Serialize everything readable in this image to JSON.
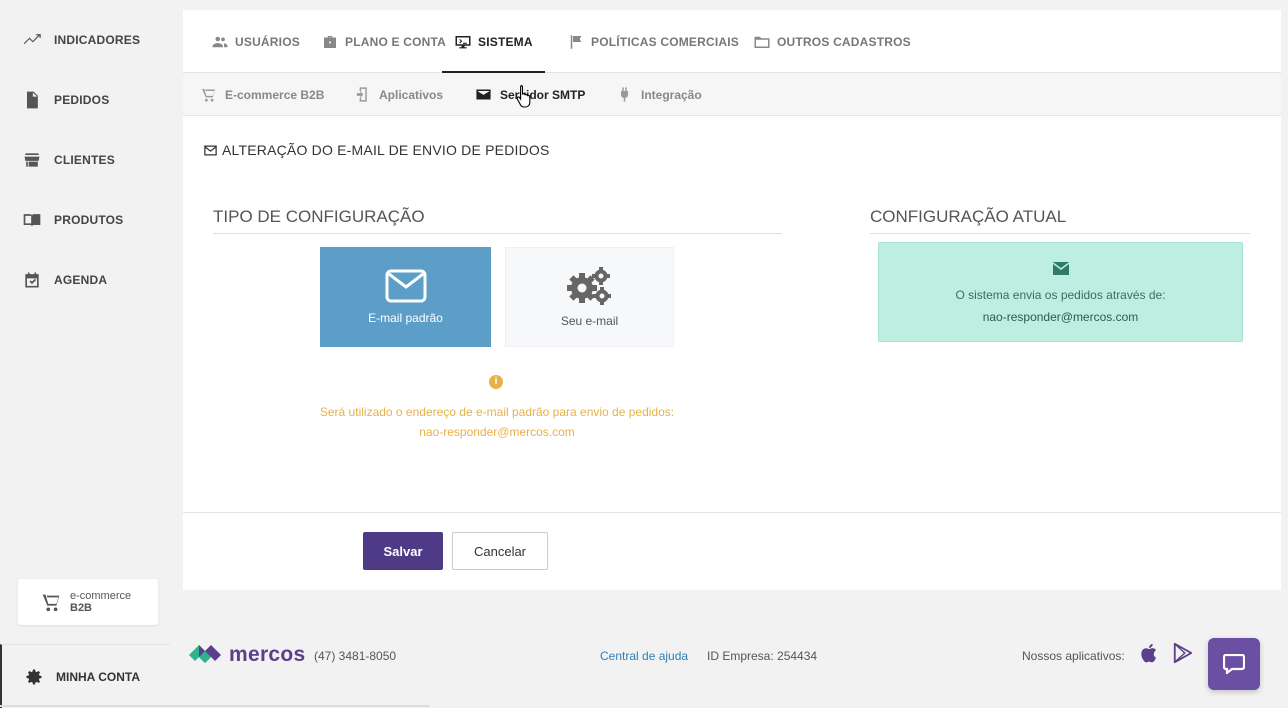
{
  "sidebar": {
    "items": [
      {
        "label": "INDICADORES",
        "icon": "trending-up-icon"
      },
      {
        "label": "PEDIDOS",
        "icon": "document-icon"
      },
      {
        "label": "CLIENTES",
        "icon": "store-icon"
      },
      {
        "label": "PRODUTOS",
        "icon": "book-icon"
      },
      {
        "label": "AGENDA",
        "icon": "calendar-check-icon"
      }
    ],
    "ecommerce": {
      "line1": "e-commerce",
      "line2": "B2B"
    },
    "account": {
      "label": "MINHA CONTA",
      "icon": "gear-icon"
    }
  },
  "tabs": [
    {
      "label": "USUÁRIOS",
      "icon": "users-icon"
    },
    {
      "label": "PLANO E CONTA",
      "icon": "briefcase-icon"
    },
    {
      "label": "SISTEMA",
      "icon": "monitor-icon",
      "active": true
    },
    {
      "label": "POLÍTICAS COMERCIAIS",
      "icon": "flag-icon"
    },
    {
      "label": "OUTROS CADASTROS",
      "icon": "folder-icon"
    }
  ],
  "subtabs": [
    {
      "label": "E-commerce B2B",
      "icon": "cart-icon"
    },
    {
      "label": "Aplicativos",
      "icon": "app-icon"
    },
    {
      "label": "Servidor SMTP",
      "icon": "envelope-icon",
      "active": true
    },
    {
      "label": "Integração",
      "icon": "plug-icon"
    }
  ],
  "section_title": "ALTERAÇÃO DO E-MAIL DE ENVIO DE PEDIDOS",
  "config_type": {
    "heading": "TIPO DE CONFIGURAÇÃO",
    "options": [
      {
        "label": "E-mail padrão",
        "selected": true
      },
      {
        "label": "Seu e-mail",
        "selected": false
      }
    ],
    "info_line1": "Será utilizado o endereço de e-mail padrão para envio de pedidos:",
    "info_line2": "nao-responder@mercos.com"
  },
  "current_config": {
    "heading": "CONFIGURAÇÃO ATUAL",
    "line1": "O sistema envia os pedidos através de:",
    "line2": "nao-responder@mercos.com"
  },
  "buttons": {
    "save": "Salvar",
    "cancel": "Cancelar"
  },
  "footer": {
    "brand": "mercos",
    "phone": "(47) 3481-8050",
    "help": "Central de ajuda",
    "company_id": "ID Empresa: 254434",
    "apps_label": "Nossos aplicativos:"
  },
  "colors": {
    "accent": "#4e3a86",
    "selected_option": "#5c9ec7",
    "info": "#e8b04a",
    "current_box": "#bdeee1"
  }
}
